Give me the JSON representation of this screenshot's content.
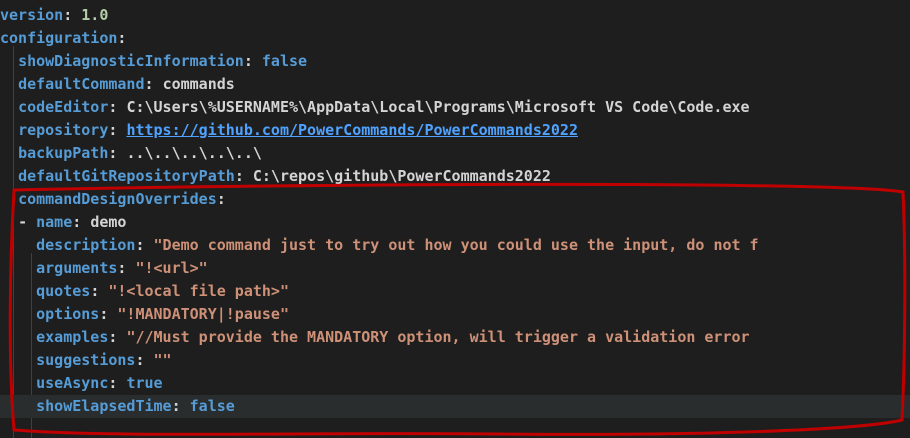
{
  "editor": {
    "colors": {
      "background": "#1e1e1e",
      "key": "#569cd6",
      "string": "#ce9178",
      "link": "#4fa3ff",
      "annotation": "#c00000"
    },
    "lines": [
      {
        "key": "version",
        "sep": ": ",
        "value": "1.0",
        "vtype": "num",
        "indent": ""
      },
      {
        "key": "configuration",
        "sep": ":",
        "value": "",
        "vtype": "plain",
        "indent": ""
      },
      {
        "key": "showDiagnosticInformation",
        "sep": ": ",
        "value": "false",
        "vtype": "bool",
        "indent": "  "
      },
      {
        "key": "defaultCommand",
        "sep": ": ",
        "value": "commands",
        "vtype": "plain",
        "indent": "  "
      },
      {
        "key": "codeEditor",
        "sep": ": ",
        "value": "C:\\Users\\%USERNAME%\\AppData\\Local\\Programs\\Microsoft VS Code\\Code.exe",
        "vtype": "plain",
        "indent": "  "
      },
      {
        "key": "repository",
        "sep": ": ",
        "value": "https://github.com/PowerCommands/PowerCommands2022",
        "vtype": "link",
        "indent": "  "
      },
      {
        "key": "backupPath",
        "sep": ": ",
        "value": "..\\..\\..\\..\\..\\",
        "vtype": "plain",
        "indent": "  "
      },
      {
        "key": "defaultGitRepositoryPath",
        "sep": ": ",
        "value": "C:\\repos\\github\\PowerCommands2022",
        "vtype": "plain",
        "indent": "  "
      },
      {
        "key": "commandDesignOverrides",
        "sep": ":",
        "value": "",
        "vtype": "plain",
        "indent": "  "
      },
      {
        "key": "name",
        "sep": ": ",
        "value": "demo",
        "vtype": "plain",
        "indent": "  ",
        "dash": "- "
      },
      {
        "key": "description",
        "sep": ": ",
        "value": "\"Demo command just to try out how you could use the input, do not f",
        "vtype": "str",
        "indent": "    "
      },
      {
        "key": "arguments",
        "sep": ": ",
        "value": "\"!<url>\"",
        "vtype": "str",
        "indent": "    "
      },
      {
        "key": "quotes",
        "sep": ": ",
        "value": "\"!<local file path>\"",
        "vtype": "str",
        "indent": "    "
      },
      {
        "key": "options",
        "sep": ": ",
        "value": "\"!MANDATORY|!pause\"",
        "vtype": "str",
        "indent": "    "
      },
      {
        "key": "examples",
        "sep": ": ",
        "value": "\"//Must provide the MANDATORY option, will trigger a validation error",
        "vtype": "str",
        "indent": "    "
      },
      {
        "key": "suggestions",
        "sep": ": ",
        "value": "\"\"",
        "vtype": "str",
        "indent": "    "
      },
      {
        "key": "useAsync",
        "sep": ": ",
        "value": "true",
        "vtype": "bool",
        "indent": "    "
      },
      {
        "key": "showElapsedTime",
        "sep": ": ",
        "value": "false",
        "vtype": "bool",
        "indent": "    ",
        "current": true
      }
    ]
  }
}
